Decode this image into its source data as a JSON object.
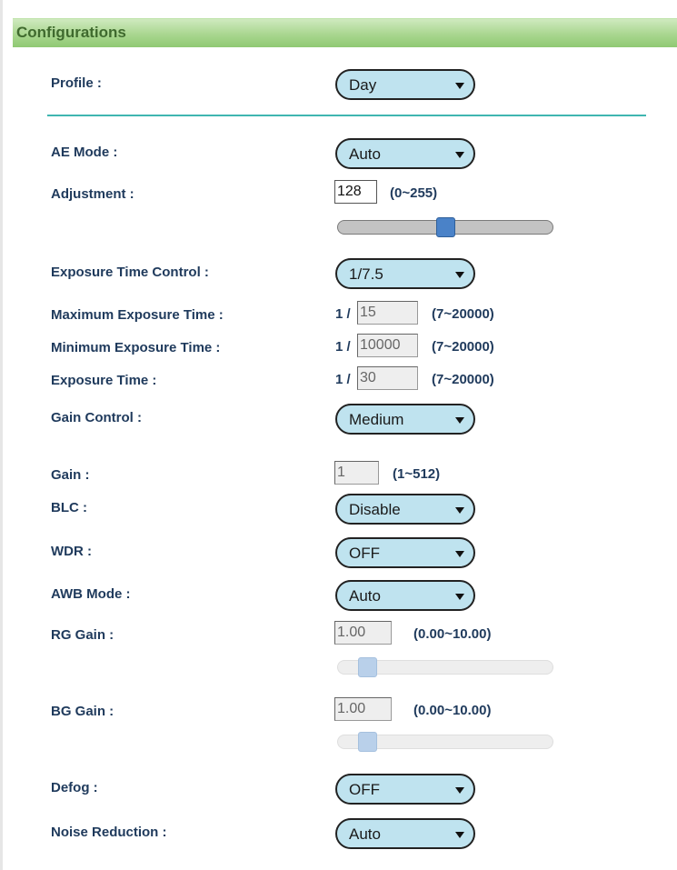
{
  "title": "Configurations",
  "profile": {
    "label": "Profile :",
    "value": "Day"
  },
  "ae_mode": {
    "label": "AE Mode :",
    "value": "Auto"
  },
  "adjustment": {
    "label": "Adjustment :",
    "value": "128",
    "range": "(0~255)",
    "level": 0.5
  },
  "exposure_time_control": {
    "label": "Exposure Time Control :",
    "value": "1/7.5"
  },
  "max_exposure_time": {
    "label": "Maximum Exposure Time :",
    "prefix": "1 /",
    "value": "15",
    "range": "(7~20000)"
  },
  "min_exposure_time": {
    "label": "Minimum Exposure Time :",
    "prefix": "1 /",
    "value": "10000",
    "range": "(7~20000)"
  },
  "exposure_time": {
    "label": "Exposure Time :",
    "prefix": "1 /",
    "value": "30",
    "range": "(7~20000)"
  },
  "gain_control": {
    "label": "Gain Control :",
    "value": "Medium"
  },
  "gain": {
    "label": "Gain :",
    "value": "1",
    "range": "(1~512)"
  },
  "blc": {
    "label": "BLC :",
    "value": "Disable"
  },
  "wdr": {
    "label": "WDR :",
    "value": "OFF"
  },
  "awb_mode": {
    "label": "AWB Mode :",
    "value": "Auto"
  },
  "rg_gain": {
    "label": "RG Gain :",
    "value": "1.00",
    "range": "(0.00~10.00)",
    "level": 0.1
  },
  "bg_gain": {
    "label": "BG Gain :",
    "value": "1.00",
    "range": "(0.00~10.00)",
    "level": 0.1
  },
  "defog": {
    "label": "Defog :",
    "value": "OFF"
  },
  "noise_reduction": {
    "label": "Noise Reduction :",
    "value": "Auto"
  },
  "colors": {
    "header_green": "#8fc973",
    "divider_teal": "#3fb6b0",
    "select_bg": "#bfe3ef",
    "label_navy": "#1f3a5c",
    "slider_thumb": "#4a82c8"
  },
  "icons": {
    "dropdown": "chevron-down-icon"
  }
}
